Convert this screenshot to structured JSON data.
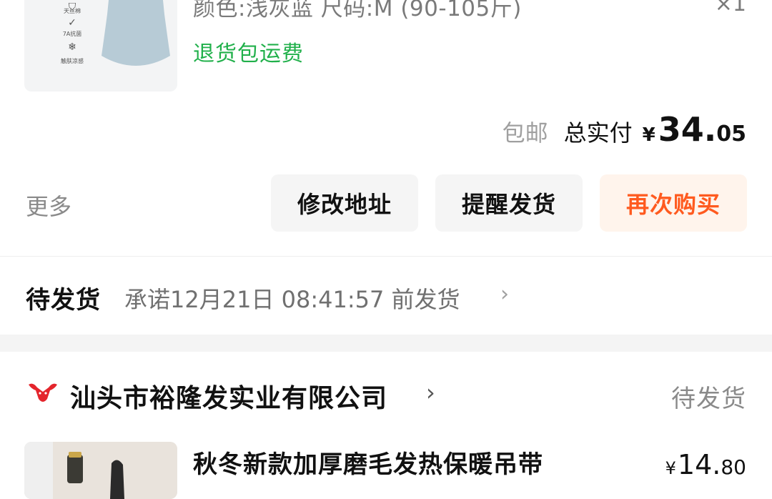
{
  "order1": {
    "badges": [
      {
        "icon": "shield-icon",
        "label": "天丝棉"
      },
      {
        "icon": "shield-check-icon",
        "label": "7A抗菌"
      },
      {
        "icon": "snowflake-icon",
        "label": "触肤凉感"
      }
    ],
    "spec": "颜色:浅灰蓝 尺码:M (90-105斤)",
    "quantity": "×1",
    "return_tag": "退货包运费",
    "free_shipping": "包邮",
    "total_label": "总实付",
    "currency": "¥",
    "price_int": "34.",
    "price_dec": "05",
    "more": "更多",
    "buttons": {
      "modify_address": "修改地址",
      "remind_ship": "提醒发货",
      "buy_again": "再次购买"
    }
  },
  "pending": {
    "title": "待发货",
    "promise": "承诺12月21日 08:41:57 前发货",
    "chevron": "›"
  },
  "order2": {
    "shop_name": "汕头市裕隆发实业有限公司",
    "shop_chevron": "›",
    "status": "待发货",
    "product_title": "秋冬新款加厚磨毛发热保暖吊带",
    "currency": "¥",
    "price_int": "14.",
    "price_dec": "80"
  },
  "colors": {
    "green": "#21b04b",
    "orange": "#ff5a1f",
    "brand_red": "#e4252c"
  }
}
